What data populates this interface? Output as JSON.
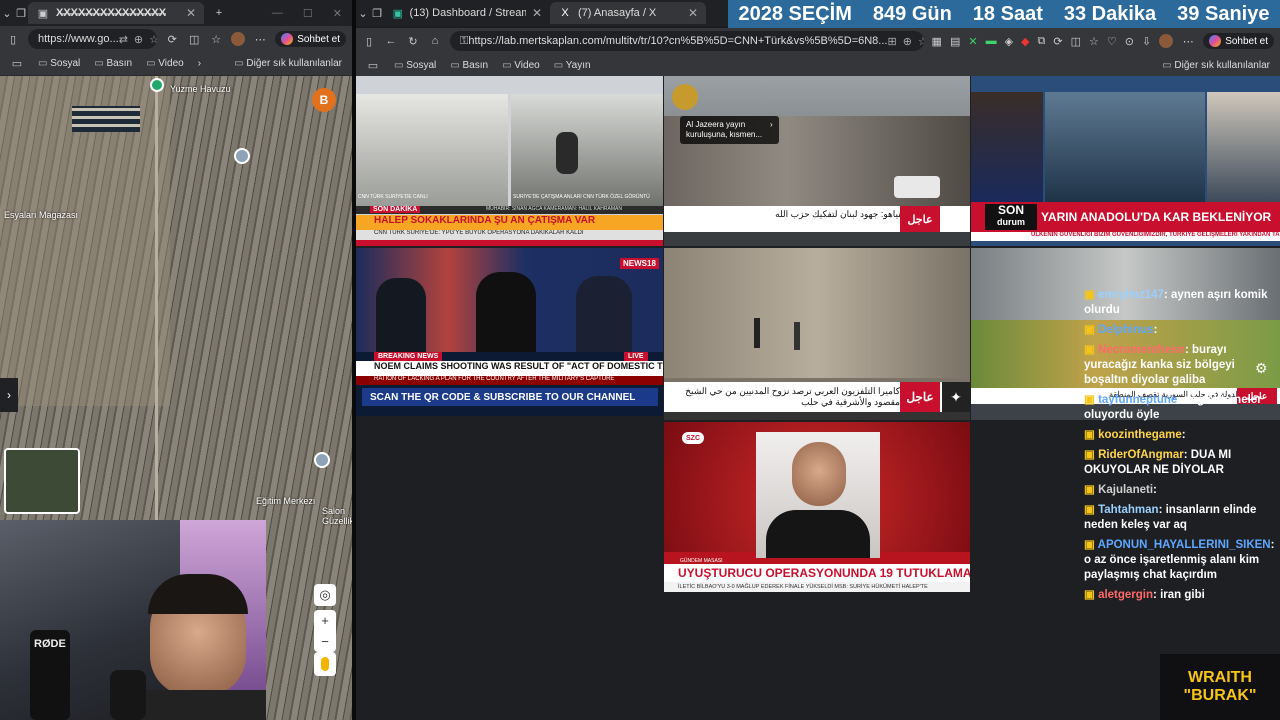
{
  "left_browser": {
    "tab_title": "X̶X̶X̶X̶X̶X̶X̶X̶X̶X̶X̶X̶X̶X̶X̶",
    "url": "https://www.go...",
    "chat_button": "Sohbet et",
    "bookmarks": [
      "Sosyal",
      "Basın",
      "Video"
    ],
    "other_bookmarks": "Diğer sık kullanılanlar",
    "map": {
      "labels": [
        "Yuzme Havuzu",
        "Esyaları Magazası",
        "Eğitim Merkezi",
        "Salon Güzellik"
      ],
      "avatar": "B"
    }
  },
  "right_browser": {
    "tabs": [
      {
        "title": "(13) Dashboard / Streamlabs"
      },
      {
        "title": "(7) Anasayfa / X"
      }
    ],
    "url": "https://lab.mertskaplan.com/multitv/tr/10?cn%5B%5D=CNN+Türk&vs%5B%5D=6N8...",
    "chat_button": "Sohbet et",
    "bookmarks": [
      "Sosyal",
      "Basın",
      "Video",
      "Yayın"
    ],
    "other_bookmarks": "Diğer sık kullanılanlar"
  },
  "countdown": {
    "label": "2028 SEÇİM",
    "days": "849 Gün",
    "hours": "18 Saat",
    "minutes": "33 Dakika",
    "seconds": "39 Saniye"
  },
  "tiles": {
    "cnnturk": {
      "tag": "SON DAKİKA",
      "headline": "HALEP SOKAKLARINDA ŞU AN ÇATIŞMA VAR",
      "sub": "CNN TÜRK SURİYE'DE: YPG'YE BÜYÜK OPERASYONA DAKİKALAR KALDI",
      "cap1": "CNN TÜRK SURİYE'DE CANLI",
      "cap2": "SURİYE'DE ÇATIŞMA ANLARI CNN TÜRK ÖZEL GÖRÜNTÜ",
      "credit": "MUHABİR: SİNAN AĞCA KAMERAMAN: HALİL KAHRAMAN"
    },
    "aljazeera": {
      "popup1": "Al Jazeera yayın",
      "popup2": "kuruluşuna, kısmen...",
      "ticker": "مكتب نتنياهو: جهود لبنان لتفكيك حزب الله",
      "tag": "عاجل"
    },
    "habertürk": {
      "tag": "SON",
      "tag2": "durum",
      "headline": "YARIN ANADOLU'DA KAR BEKLENİYOR",
      "sub": "ÜLKENİN GÜVENLİĞİ BİZİM GÜVENLİĞİMİZDİR, TÜRKİYE GELİŞMELERİ YAKINDAN TAKİP ED"
    },
    "news18": {
      "tag": "BREAKING NEWS",
      "headline": "NOEM CLAIMS SHOOTING WAS RESULT OF \"ACT OF DOMESTIC TERRORISM\"",
      "sub": "RATION OF LACKING A PLAN FOR THE COUNTRY AFTER THE MILITARY'S CAPTURE",
      "bar": "SCAN THE QR CODE & SUBSCRIBE TO OUR CHANNEL",
      "live": "LIVE",
      "logo": "NEWS18"
    },
    "alaraby": {
      "ticker": "كاميرا التلفزيون العربي ترصد نزوح المدنيين من حي الشيخ مقصود والأشرفية في حلب",
      "tag": "عاجل"
    },
    "alaraby2": {
      "ticker": "الدولة في حلب السورية تقصف المنطقة",
      "tag": "عاجل"
    },
    "szc": {
      "logo": "SZC",
      "section": "GÜNDEM MASASI",
      "headline": "UYUŞTURUCU OPERASYONUNDA 19 TUTUKLAMA",
      "sub": "İLETİC BİLBAO'YU 3-0 MAĞLUP EDEREK FİNALE YÜKSELDİ   MSB: SURİYE HÜKÜMETİ HALEP'TE"
    }
  },
  "chat": [
    {
      "user": "emrylmz147",
      "text": "aynen aşırı komik olurdu",
      "color": "#9ad0ff"
    },
    {
      "user": "Delphinus",
      "text": "",
      "color": "#5fa8ff"
    },
    {
      "user": "Necromenthesn",
      "text": "burayı yuracağız kanka siz bölgeyi boşaltın diyolar galiba",
      "color": "#ff6a6a"
    },
    {
      "user": "tayfunneptune",
      "text": "sag altta neler oluyordu öyle",
      "color": "#5fa8ff"
    },
    {
      "user": "koozinthegame",
      "text": "",
      "color": "#ffd54a"
    },
    {
      "user": "RiderOfAngmar",
      "text": "DUA MI OKUYOLAR NE DİYOLAR",
      "color": "#ffd54a"
    },
    {
      "user": "Kajulaneti",
      "text": "",
      "color": "#cfcfcf"
    },
    {
      "user": "Tahtahman",
      "text": "insanların elinde neden keleş var aq",
      "color": "#9ad0ff"
    },
    {
      "user": "APONUN_HAYALLERINI_SIKEN",
      "text": "o az önce işaretlenmiş alanı kim paylaşmış chat kaçırdım",
      "color": "#5fa8ff"
    },
    {
      "user": "aletgergin",
      "text": "iran gibi",
      "color": "#ff6a6a"
    }
  ],
  "webcam": {
    "mic_label": "RØDE"
  },
  "brand": {
    "line1": "WRAITH",
    "line2": "\"BURAK\""
  }
}
